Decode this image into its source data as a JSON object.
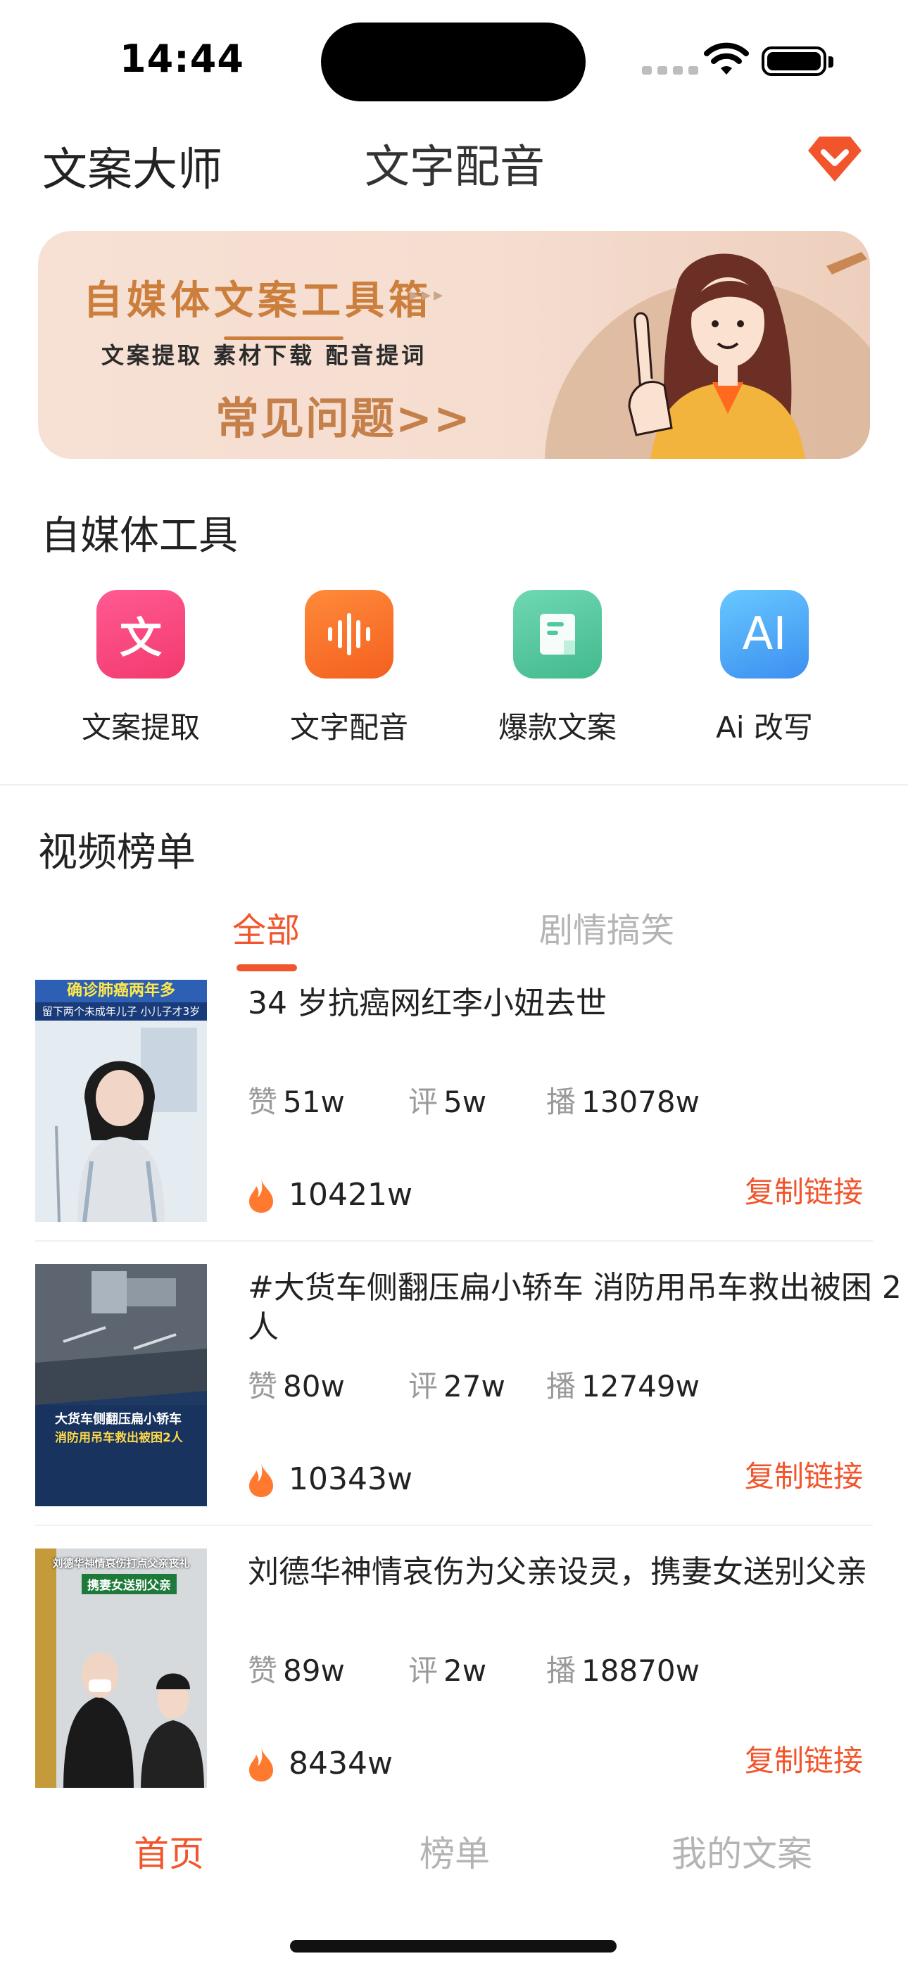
{
  "status_bar": {
    "time": "14:44"
  },
  "header": {
    "app_title": "文案大师",
    "tab": "文字配音"
  },
  "banner": {
    "title": "自媒体文案工具箱",
    "arrows": "▸▸▸",
    "subtitle": "文案提取 素材下载 配音提词",
    "cta": "常见问题>>"
  },
  "tools_section": {
    "title": "自媒体工具",
    "items": [
      {
        "label": "文案提取",
        "icon": "wen-text-icon",
        "glyph": "文",
        "color": "#f7477f"
      },
      {
        "label": "文字配音",
        "icon": "sound-wave-icon",
        "color": "#fb6d2f"
      },
      {
        "label": "爆款文案",
        "icon": "document-icon",
        "color": "#52c8a0"
      },
      {
        "label": "Ai 改写",
        "icon": "ai-icon",
        "glyph": "AI",
        "color": "#4ea7f5"
      }
    ]
  },
  "ranking": {
    "title": "视频榜单",
    "filters": [
      "全部",
      "剧情搞笑"
    ],
    "stat_labels": {
      "likes": "赞",
      "comments": "评",
      "plays": "播"
    },
    "copy_label": "复制链接",
    "videos": [
      {
        "title": "34 岁抗癌网红李小妞去世",
        "likes": "51w",
        "comments": "5w",
        "plays": "13078w",
        "heat": "10421w",
        "thumb_caption_top": "确诊肺癌两年多",
        "thumb_caption_sub": "留下两个未成年儿子 小儿子才3岁"
      },
      {
        "title": "#大货车侧翻压扁小轿车 消防用吊车救出被困 2 人",
        "likes": "80w",
        "comments": "27w",
        "plays": "12749w",
        "heat": "10343w",
        "thumb_caption_top": "大货车侧翻压扁小轿车",
        "thumb_caption_sub": "消防用吊车救出被困2人"
      },
      {
        "title": "刘德华神情哀伤为父亲设灵，携妻女送别父亲",
        "likes": "89w",
        "comments": "2w",
        "plays": "18870w",
        "heat": "8434w",
        "thumb_caption_top": "刘德华神情哀伤打点父亲丧礼",
        "thumb_caption_sub": "携妻女送别父亲"
      }
    ]
  },
  "bottom_nav": {
    "items": [
      {
        "label": "首页",
        "active": true
      },
      {
        "label": "榜单",
        "active": false
      },
      {
        "label": "我的文案",
        "active": false
      }
    ]
  },
  "colors": {
    "accent": "#f2552c",
    "banner_text": "#cc7f3c",
    "muted": "#b4b4b4"
  }
}
